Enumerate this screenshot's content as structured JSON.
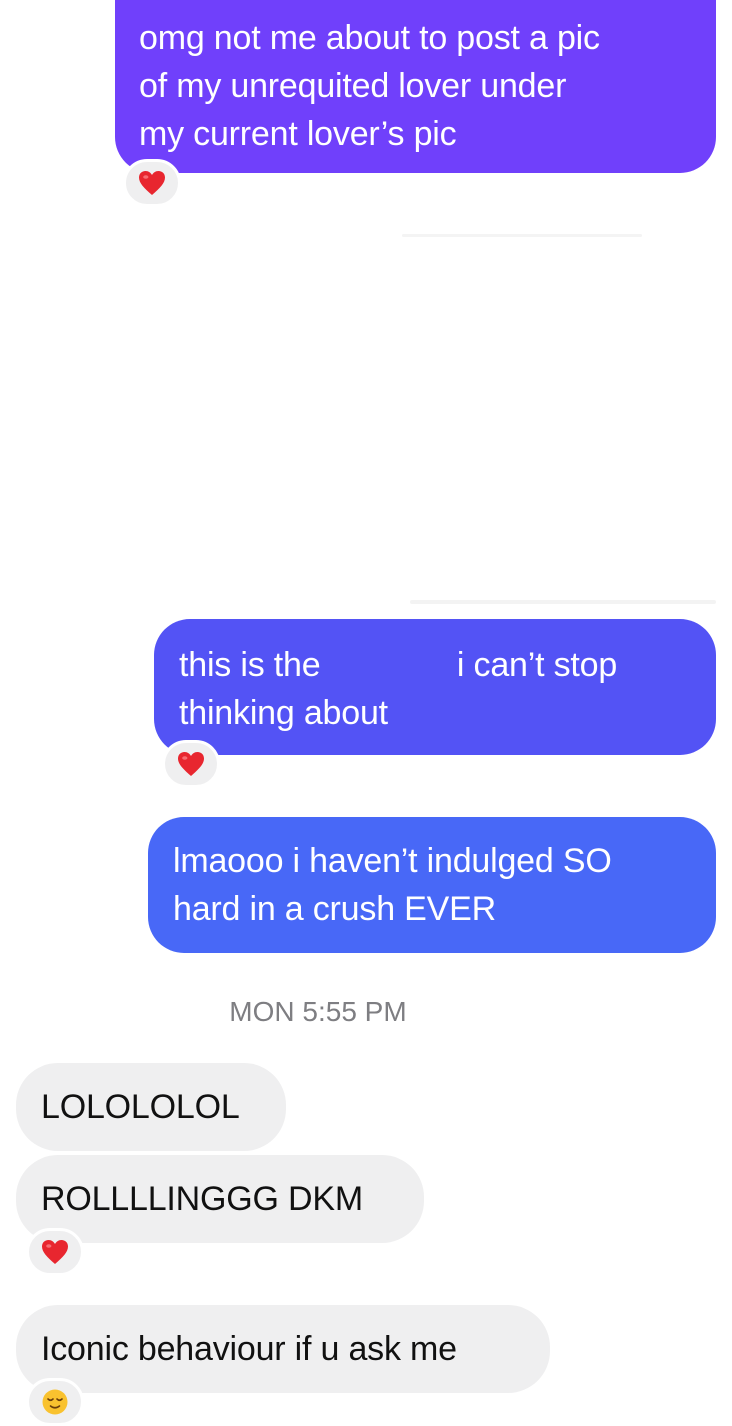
{
  "messages": {
    "m1": {
      "line1": "omg not me about to post a pic",
      "line2": "of my unrequited lover under",
      "line3": "my current lover’s pic"
    },
    "m2": {
      "text_a": "this is the ",
      "text_b": " i can’t stop",
      "line2": "thinking about"
    },
    "m3": {
      "line1": "lmaooo i haven’t indulged SO",
      "line2": "hard in a crush EVER"
    },
    "timestamp": "MON 5:55 PM",
    "m4": {
      "text": "LOLOLOLOL"
    },
    "m5": {
      "text": "ROLLLLINGGG DKM"
    },
    "m6": {
      "text": "Iconic behaviour if u ask me"
    }
  },
  "reactions": [
    {
      "icon": "red-heart-icon",
      "color": "#e8262f"
    },
    {
      "icon": "red-heart-icon",
      "color": "#e8262f"
    },
    {
      "icon": "red-heart-icon",
      "color": "#e8262f"
    },
    {
      "icon": "relieved-face-icon",
      "color": "#f9c22f"
    }
  ],
  "colors": {
    "sent_purple": "#7040fb",
    "sent_indigo": "#5353f5",
    "sent_blue": "#4868f7",
    "received_gray": "#efeff0",
    "timestamp_gray": "#7e7e82"
  }
}
